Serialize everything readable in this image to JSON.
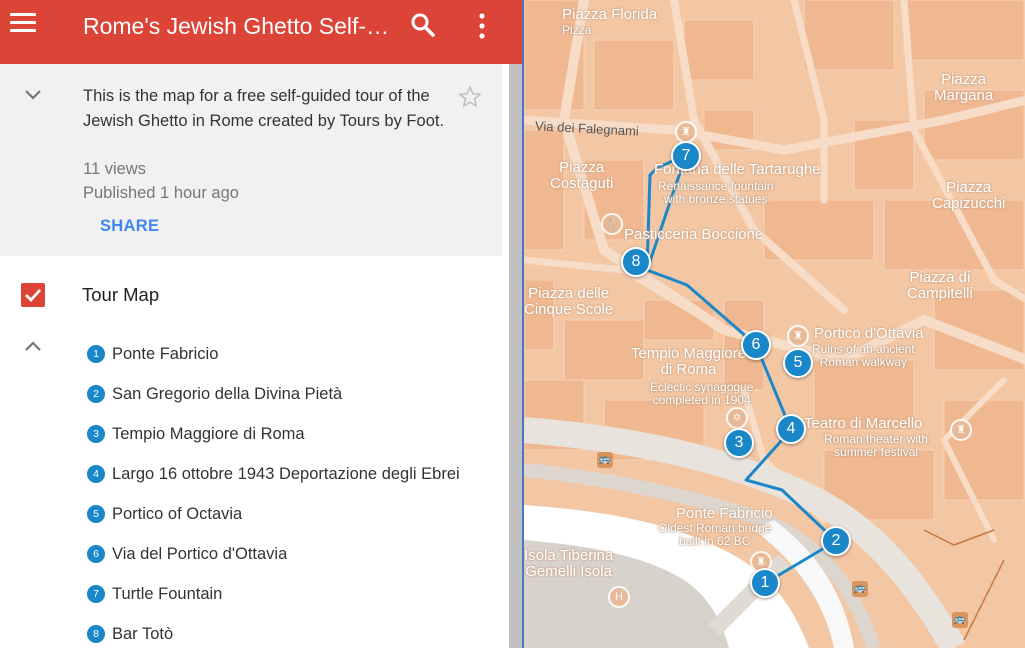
{
  "header": {
    "title": "Rome's Jewish Ghetto Self-Guided Tour",
    "menu_icon": "hamburger-menu-icon",
    "search_icon": "search-icon",
    "more_icon": "more-vertical-icon",
    "bar_color": "#db4437"
  },
  "info": {
    "description": "This is the map for a free self-guided tour of the Jewish Ghetto in Rome created by Tours by Foot.",
    "views": "11 views",
    "published": "Published 1 hour ago",
    "share_label": "SHARE"
  },
  "layer": {
    "title": "Tour Map",
    "checked": true,
    "places": [
      {
        "num": "1",
        "label": "Ponte Fabricio"
      },
      {
        "num": "2",
        "label": "San Gregorio della Divina Pietà"
      },
      {
        "num": "3",
        "label": "Tempio Maggiore di Roma"
      },
      {
        "num": "4",
        "label": "Largo 16 ottobre 1943 Deportazione degli Ebrei"
      },
      {
        "num": "5",
        "label": "Portico of Octavia"
      },
      {
        "num": "6",
        "label": "Via del Portico d'Ottavia"
      },
      {
        "num": "7",
        "label": "Turtle Fountain"
      },
      {
        "num": "8",
        "label": "Bar Totò"
      }
    ]
  },
  "map": {
    "route_color": "#1a87c9",
    "labels": {
      "piazza_florida": "Piazza Florida",
      "piazza_florida_sub": "Pizza",
      "piazza_margana": "Piazza\nMargana",
      "via_falegnami": "Via dei Falegnami",
      "piazza_costaguti": "Piazza\nCostaguti",
      "fontana_tartarughe": "Fontana delle Tartarughe",
      "fontana_sub": "Renaissance fountain\nwith bronze statues",
      "piazza_capizucchi": "Piazza\nCapizucchi",
      "pasticceria": "Pasticceria Boccione",
      "piazza_campitelli": "Piazza di\nCampitelli",
      "piazza_cinque_scole": "Piazza delle\nCinque Scole",
      "portico_ottavia": "Portico d'Ottavia",
      "portico_sub": "Ruins of an ancient\nRoman walkway",
      "tempio": "Tempio Maggiore\ndi Roma",
      "tempio_sub": "Eclectic synagogue\ncompleted in 1904",
      "teatro": "Teatro di Marcello",
      "teatro_sub": "Roman theater with\nsummer festival",
      "ponte_fabricio": "Ponte Fabricio",
      "ponte_sub": "Oldest Roman bridge\nbuilt in 62 BC",
      "isola": "Isola Tiberina\nGemelli Isola"
    }
  }
}
